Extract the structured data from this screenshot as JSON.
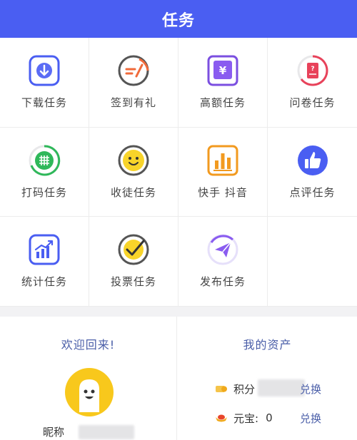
{
  "header": {
    "title": "任务"
  },
  "tasks": [
    {
      "label": "下载任务",
      "icon": "download-icon"
    },
    {
      "label": "签到有礼",
      "icon": "sign-in-icon"
    },
    {
      "label": "高额任务",
      "icon": "yen-icon"
    },
    {
      "label": "问卷任务",
      "icon": "questionnaire-icon"
    },
    {
      "label": "打码任务",
      "icon": "grid-icon"
    },
    {
      "label": "收徒任务",
      "icon": "smiley-icon"
    },
    {
      "label": "快手 抖音",
      "icon": "bar-chart-icon"
    },
    {
      "label": "点评任务",
      "icon": "thumbs-up-icon"
    },
    {
      "label": "统计任务",
      "icon": "stats-icon"
    },
    {
      "label": "投票任务",
      "icon": "vote-check-icon"
    },
    {
      "label": "发布任务",
      "icon": "send-icon"
    }
  ],
  "welcome": {
    "title": "欢迎回来!",
    "nickname_label": "昵称"
  },
  "assets": {
    "title": "我的资产",
    "points_label": "积分",
    "points_exchange": "兑换",
    "yuanbao_label": "元宝:",
    "yuanbao_value": "0",
    "yuanbao_exchange": "兑换"
  },
  "colors": {
    "header": "#4a5ef2",
    "accent": "#4a5ea8"
  }
}
